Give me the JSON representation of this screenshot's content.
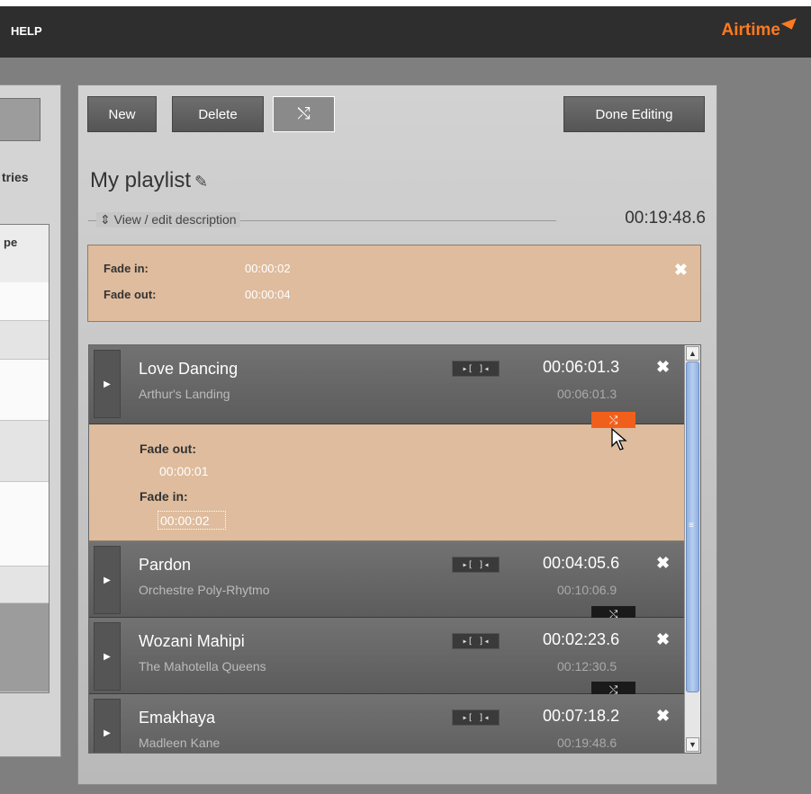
{
  "topbar": {
    "help": "HELP",
    "logo": "Airtime"
  },
  "left": {
    "entries_text": "tries",
    "column_header": "pe"
  },
  "toolbar": {
    "new": "New",
    "delete": "Delete",
    "shuffle_icon": "⤭",
    "done": "Done Editing"
  },
  "playlist": {
    "title": "My playlist",
    "edit_icon": "✎",
    "description_link": "⇕ View / edit description",
    "total_length": "00:19:48.6"
  },
  "fades": {
    "fade_in_label": "Fade in:",
    "fade_in_value": "00:00:02",
    "fade_out_label": "Fade out:",
    "fade_out_value": "00:00:04",
    "close": "✖"
  },
  "tracks": [
    {
      "title": "Love Dancing",
      "artist": "Arthur's Landing",
      "length": "00:06:01.3",
      "offset": "00:06:01.3",
      "cue": "▸[ ]◂",
      "remove": "✖"
    },
    {
      "title": "Pardon",
      "artist": "Orchestre Poly-Rhytmo",
      "length": "00:04:05.6",
      "offset": "00:10:06.9",
      "cue": "▸[ ]◂",
      "remove": "✖"
    },
    {
      "title": "Wozani Mahipi",
      "artist": "The Mahotella Queens",
      "length": "00:02:23.6",
      "offset": "00:12:30.5",
      "cue": "▸[ ]◂",
      "remove": "✖"
    },
    {
      "title": "Emakhaya",
      "artist": "Madleen Kane",
      "length": "00:07:18.2",
      "offset": "00:19:48.6",
      "cue": "▸[ ]◂",
      "remove": "✖"
    }
  ],
  "crossfade": {
    "fade_out_label": "Fade out:",
    "fade_out_value": "00:00:01",
    "fade_in_label": "Fade in:",
    "fade_in_value": "00:00:02"
  },
  "icons": {
    "play": "▶",
    "crossfade": "⤭",
    "scroll_up": "▲",
    "scroll_down": "▼",
    "scroll_grip": "≡"
  }
}
